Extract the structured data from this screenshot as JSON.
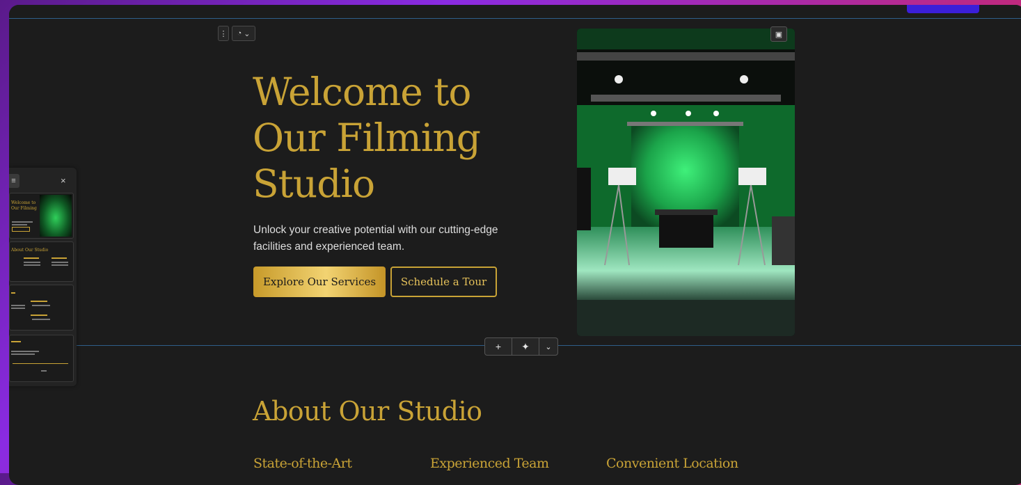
{
  "hero": {
    "title_lines": [
      "Welcome to",
      "Our Filming",
      "Studio"
    ],
    "subtitle": "Unlock your creative potential with our cutting-edge facilities and experienced team.",
    "primary_button": "Explore Our Services",
    "secondary_button": "Schedule a Tour"
  },
  "editor": {
    "section_menu_icon": "vertical-dots-icon",
    "palette_icon": "palette-icon",
    "image_edit_icon": "image-edit-icon",
    "add_bar": {
      "add": "+",
      "ai": "✦",
      "more": "⌄"
    },
    "side_panel_close": "×"
  },
  "about": {
    "title": "About Our Studio",
    "features": [
      "State-of-the-Art",
      "Experienced Team",
      "Convenient Location"
    ]
  },
  "colors": {
    "gold": "#c9a336",
    "background": "#1c1c1c",
    "accent_line": "#2f5f8a"
  }
}
